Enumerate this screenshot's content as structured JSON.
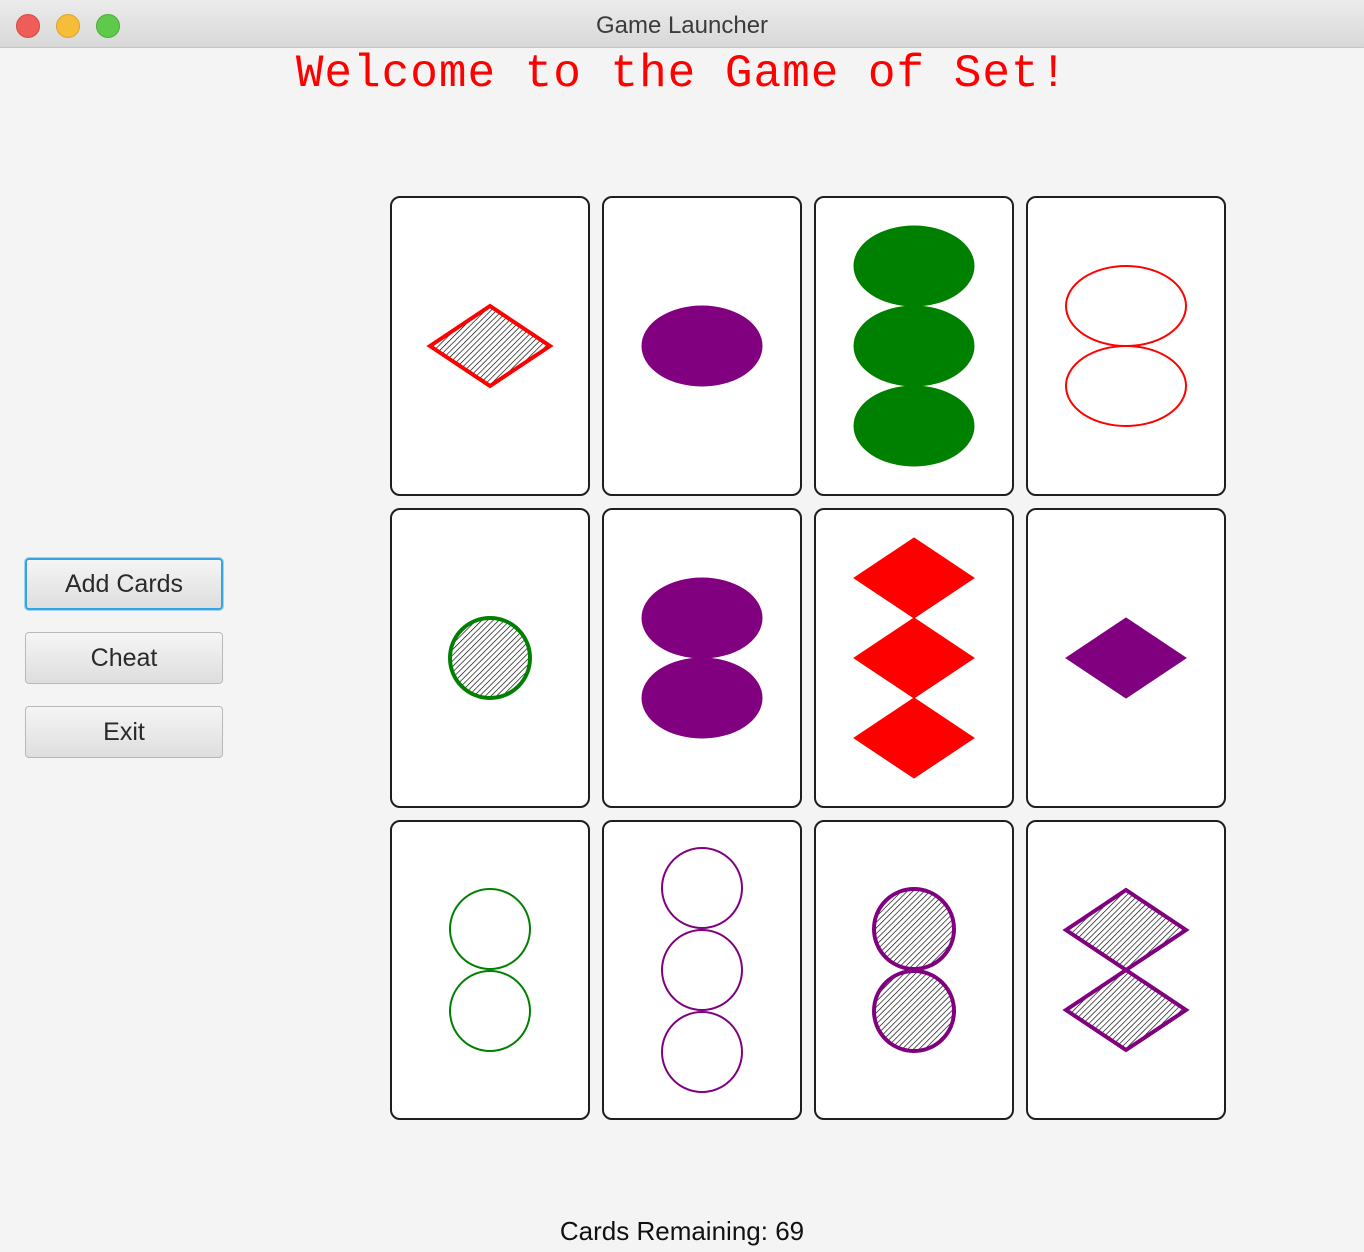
{
  "window": {
    "title": "Game Launcher"
  },
  "header": {
    "welcome": "Welcome to the Game of Set!"
  },
  "sidebar": {
    "buttons": [
      {
        "label": "Add Cards",
        "focused": true
      },
      {
        "label": "Cheat",
        "focused": false
      },
      {
        "label": "Exit",
        "focused": false
      }
    ]
  },
  "colors": {
    "red": "#ff0000",
    "green": "#008000",
    "purple": "#800080",
    "focus_ring": "#35a4e0"
  },
  "cards": [
    {
      "count": 1,
      "shape": "diamond",
      "color": "red",
      "fill": "striped"
    },
    {
      "count": 1,
      "shape": "oval",
      "color": "purple",
      "fill": "solid"
    },
    {
      "count": 3,
      "shape": "oval",
      "color": "green",
      "fill": "solid"
    },
    {
      "count": 2,
      "shape": "oval",
      "color": "red",
      "fill": "outline"
    },
    {
      "count": 1,
      "shape": "circle",
      "color": "green",
      "fill": "striped"
    },
    {
      "count": 2,
      "shape": "oval",
      "color": "purple",
      "fill": "solid"
    },
    {
      "count": 3,
      "shape": "diamond",
      "color": "red",
      "fill": "solid"
    },
    {
      "count": 1,
      "shape": "diamond",
      "color": "purple",
      "fill": "solid"
    },
    {
      "count": 2,
      "shape": "circle",
      "color": "green",
      "fill": "outline"
    },
    {
      "count": 3,
      "shape": "circle",
      "color": "purple",
      "fill": "outline"
    },
    {
      "count": 2,
      "shape": "circle",
      "color": "purple",
      "fill": "striped"
    },
    {
      "count": 2,
      "shape": "diamond",
      "color": "purple",
      "fill": "striped"
    }
  ],
  "status": {
    "cards_remaining": "Cards Remaining: 69"
  }
}
